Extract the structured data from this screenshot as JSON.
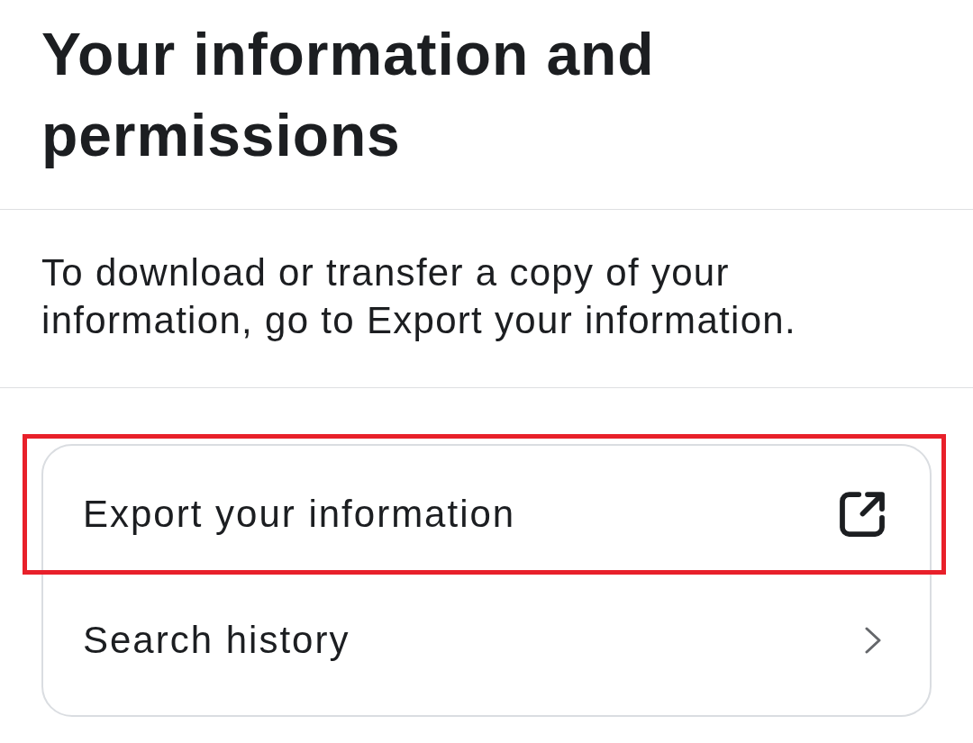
{
  "header": {
    "title": "Your information and permissions"
  },
  "description": "To download or transfer a copy of your information, go to Export your information.",
  "menu": {
    "items": [
      {
        "label": "Export your information",
        "kind": "external",
        "highlighted": true
      },
      {
        "label": "Search history",
        "kind": "chevron",
        "highlighted": false
      }
    ]
  }
}
